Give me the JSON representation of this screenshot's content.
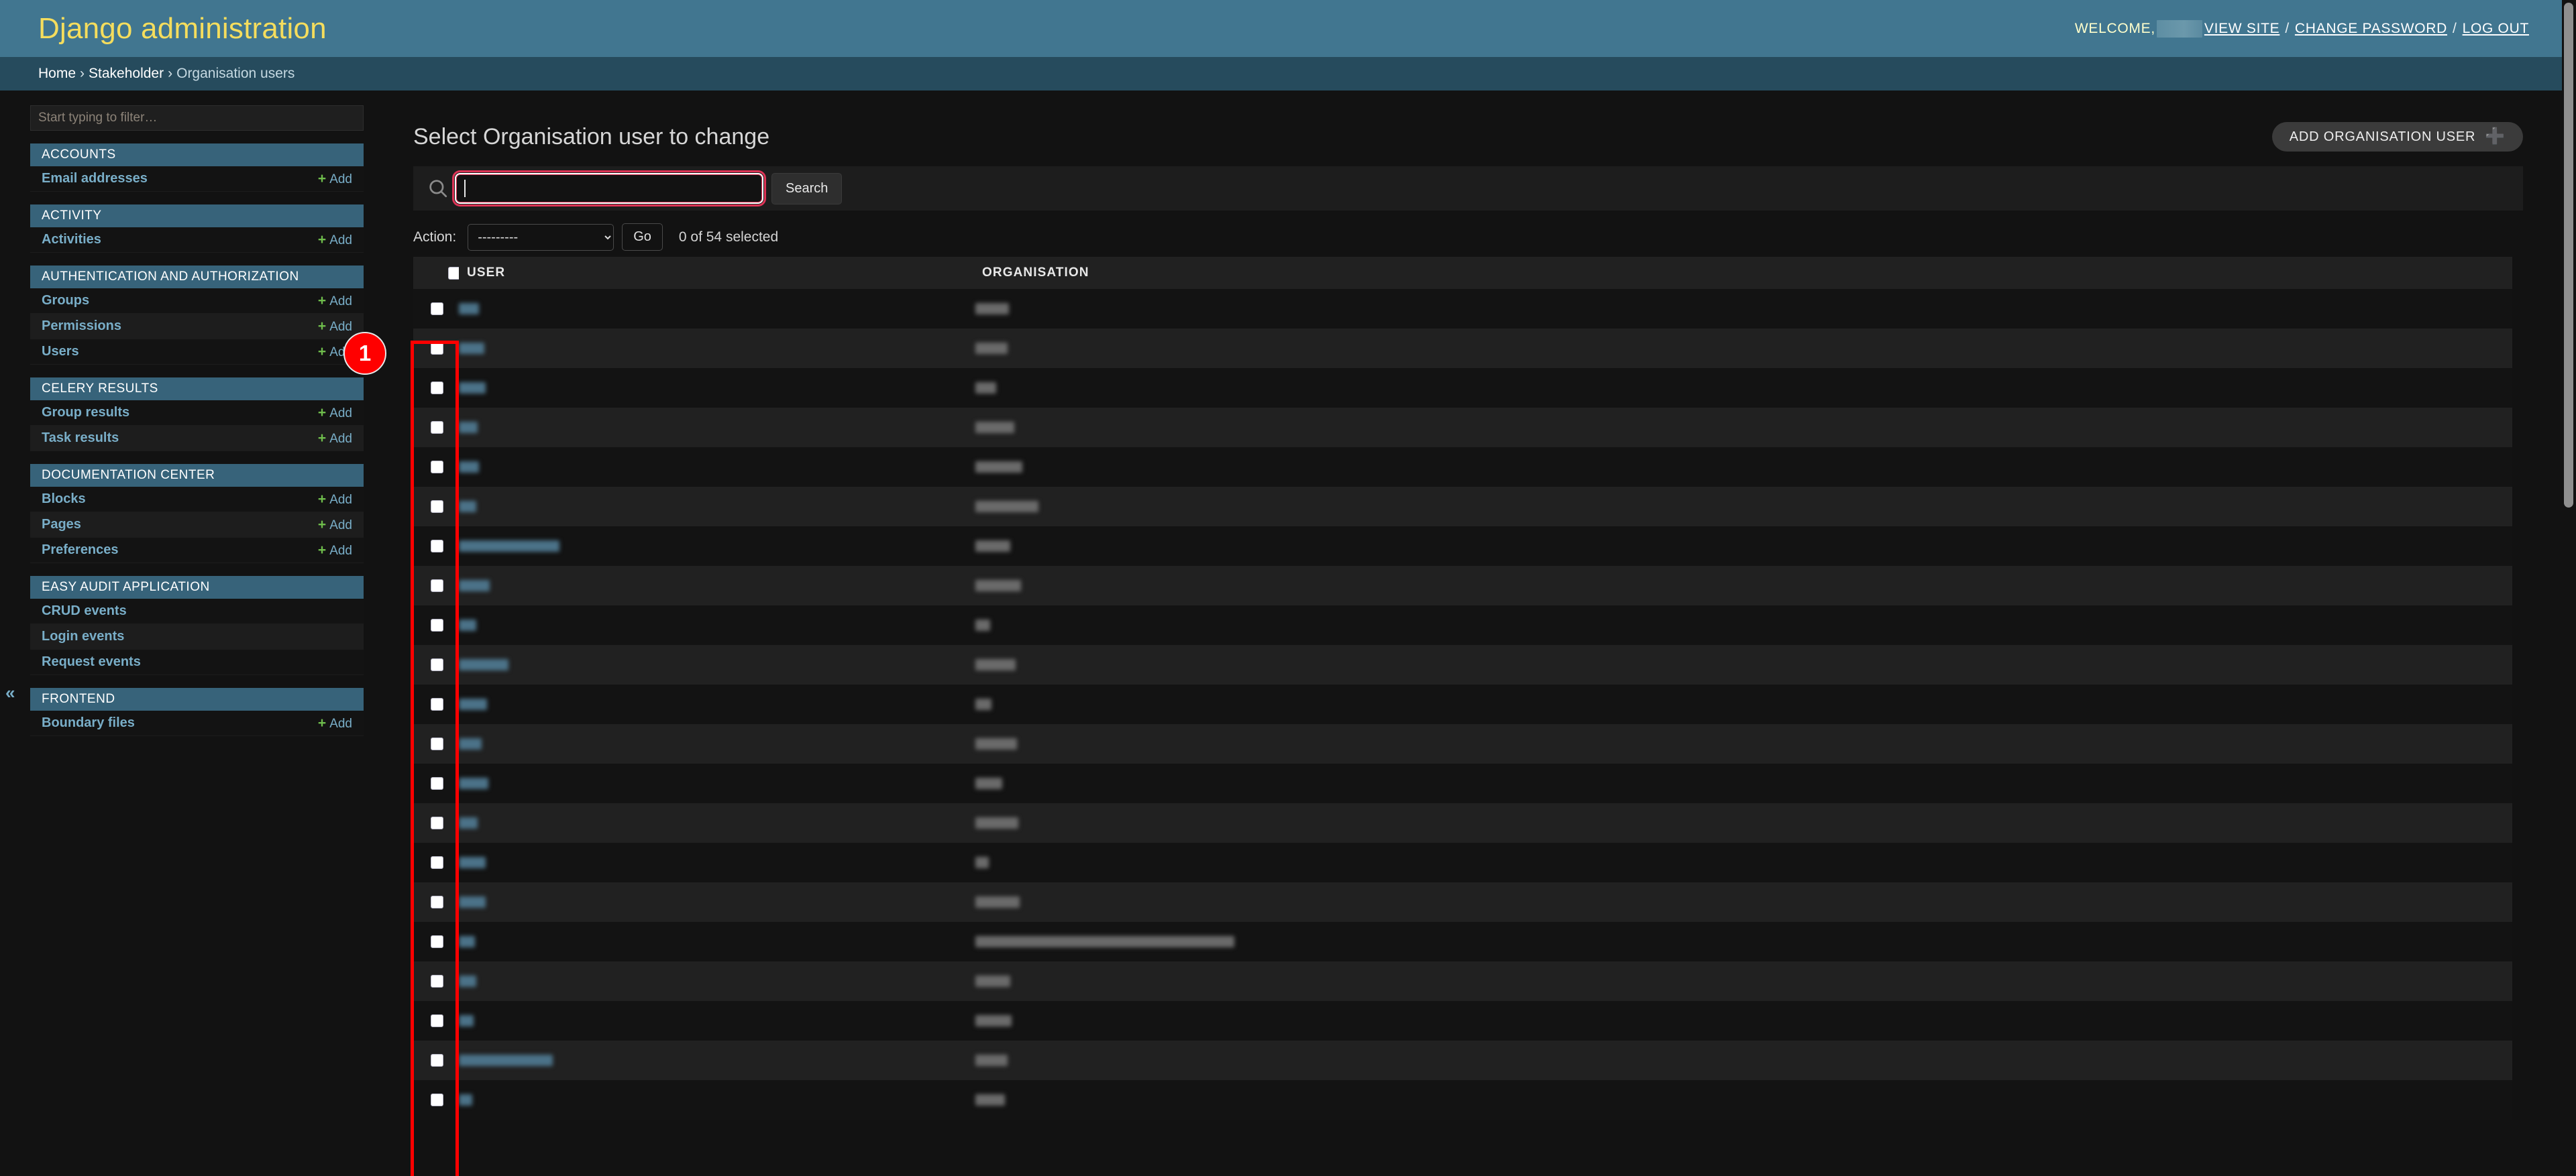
{
  "header": {
    "brand": "Django administration",
    "welcome_label": "WELCOME,",
    "username_redacted": "",
    "view_site": "VIEW SITE",
    "change_password": "CHANGE PASSWORD",
    "log_out": "LOG OUT",
    "separator": "/",
    "bg_color": "#417690",
    "brand_color": "#f5dd5d"
  },
  "breadcrumbs": {
    "home": "Home",
    "app": "Stakeholder",
    "current": "Organisation users",
    "separator": "›"
  },
  "sidebar": {
    "filter_placeholder": "Start typing to filter…",
    "filter_value": "",
    "collapse_icon": "«",
    "add_label": "Add",
    "apps": [
      {
        "caption": "ACCOUNTS",
        "models": [
          {
            "label": "Email addresses",
            "has_add": true
          }
        ]
      },
      {
        "caption": "ACTIVITY",
        "models": [
          {
            "label": "Activities",
            "has_add": true
          }
        ]
      },
      {
        "caption": "AUTHENTICATION AND AUTHORIZATION",
        "models": [
          {
            "label": "Groups",
            "has_add": true
          },
          {
            "label": "Permissions",
            "has_add": true
          },
          {
            "label": "Users",
            "has_add": true
          }
        ]
      },
      {
        "caption": "CELERY RESULTS",
        "models": [
          {
            "label": "Group results",
            "has_add": true
          },
          {
            "label": "Task results",
            "has_add": true
          }
        ]
      },
      {
        "caption": "DOCUMENTATION CENTER",
        "models": [
          {
            "label": "Blocks",
            "has_add": true
          },
          {
            "label": "Pages",
            "has_add": true
          },
          {
            "label": "Preferences",
            "has_add": true
          }
        ]
      },
      {
        "caption": "EASY AUDIT APPLICATION",
        "models": [
          {
            "label": "CRUD events",
            "has_add": false
          },
          {
            "label": "Login events",
            "has_add": false
          },
          {
            "label": "Request events",
            "has_add": false
          }
        ]
      },
      {
        "caption": "FRONTEND",
        "models": [
          {
            "label": "Boundary files",
            "has_add": true
          }
        ]
      }
    ]
  },
  "main": {
    "page_title": "Select Organisation user to change",
    "add_button": "ADD ORGANISATION USER",
    "add_button_icon": "plus-icon",
    "search": {
      "icon": "search-icon",
      "placeholder": "",
      "value": "",
      "button_label": "Search",
      "highlight_color": "#dd3355"
    },
    "actions": {
      "label": "Action:",
      "selected": "---------",
      "options": [
        "---------"
      ],
      "go_label": "Go",
      "selection_counter": "0 of 54 selected"
    },
    "table": {
      "columns": [
        "",
        "USER",
        "ORGANISATION"
      ],
      "select_all_name": "select-all-checkbox",
      "total_rows": 54,
      "rows": [
        {
          "user_redacted_width": 30,
          "org_redacted_width": 50
        },
        {
          "user_redacted_width": 38,
          "org_redacted_width": 48
        },
        {
          "user_redacted_width": 40,
          "org_redacted_width": 31
        },
        {
          "user_redacted_width": 28,
          "org_redacted_width": 58
        },
        {
          "user_redacted_width": 30,
          "org_redacted_width": 70
        },
        {
          "user_redacted_width": 26,
          "org_redacted_width": 94
        },
        {
          "user_redacted_width": 150,
          "org_redacted_width": 52
        },
        {
          "user_redacted_width": 46,
          "org_redacted_width": 68
        },
        {
          "user_redacted_width": 26,
          "org_redacted_width": 22
        },
        {
          "user_redacted_width": 74,
          "org_redacted_width": 60
        },
        {
          "user_redacted_width": 42,
          "org_redacted_width": 24
        },
        {
          "user_redacted_width": 34,
          "org_redacted_width": 62
        },
        {
          "user_redacted_width": 44,
          "org_redacted_width": 40
        },
        {
          "user_redacted_width": 28,
          "org_redacted_width": 64
        },
        {
          "user_redacted_width": 40,
          "org_redacted_width": 20
        },
        {
          "user_redacted_width": 40,
          "org_redacted_width": 66
        },
        {
          "user_redacted_width": 24,
          "org_redacted_width": 386
        },
        {
          "user_redacted_width": 26,
          "org_redacted_width": 52
        },
        {
          "user_redacted_width": 22,
          "org_redacted_width": 54
        },
        {
          "user_redacted_width": 140,
          "org_redacted_width": 48
        },
        {
          "user_redacted_width": 20,
          "org_redacted_width": 44
        }
      ]
    }
  },
  "annotation": {
    "badge_number": "1",
    "box_color": "#ff0000",
    "target": "row-select-checkbox-column"
  },
  "scrollbar": {
    "thumb_color": "#8f8f8f"
  }
}
